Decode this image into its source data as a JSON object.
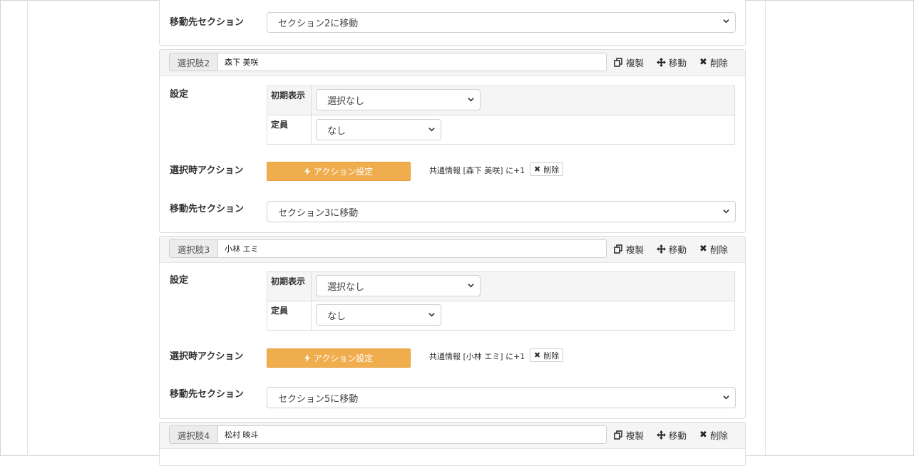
{
  "labels": {
    "destination_section": "移動先セクション",
    "settings": "設定",
    "initial_display": "初期表示",
    "capacity": "定員",
    "select_action": "選択時アクション",
    "action_settings_button": "アクション設定",
    "duplicate": "複製",
    "move": "移動",
    "delete": "削除",
    "delete_small": "削除"
  },
  "icons": {
    "duplicate": "copy-icon",
    "move": "move-arrows-icon",
    "delete": "close-icon",
    "action": "bolt-icon",
    "select": "chevron-down-icon"
  },
  "colors": {
    "action_button": "#f0ad4e",
    "panel_header": "#f5f5f5"
  },
  "top_fragment": {
    "destination_value": "セクション2に移動"
  },
  "choices": [
    {
      "prefix": "選択肢2",
      "name": "森下 美咲",
      "initial_display_value": "選択なし",
      "capacity_value": "なし",
      "action_text": "共通情報 [森下 美咲] に+1",
      "destination_value": "セクション3に移動"
    },
    {
      "prefix": "選択肢3",
      "name": "小林 エミ",
      "initial_display_value": "選択なし",
      "capacity_value": "なし",
      "action_text": "共通情報 [小林 エミ] に+1",
      "destination_value": "セクション5に移動"
    },
    {
      "prefix": "選択肢4",
      "name": "松村 映斗"
    }
  ]
}
